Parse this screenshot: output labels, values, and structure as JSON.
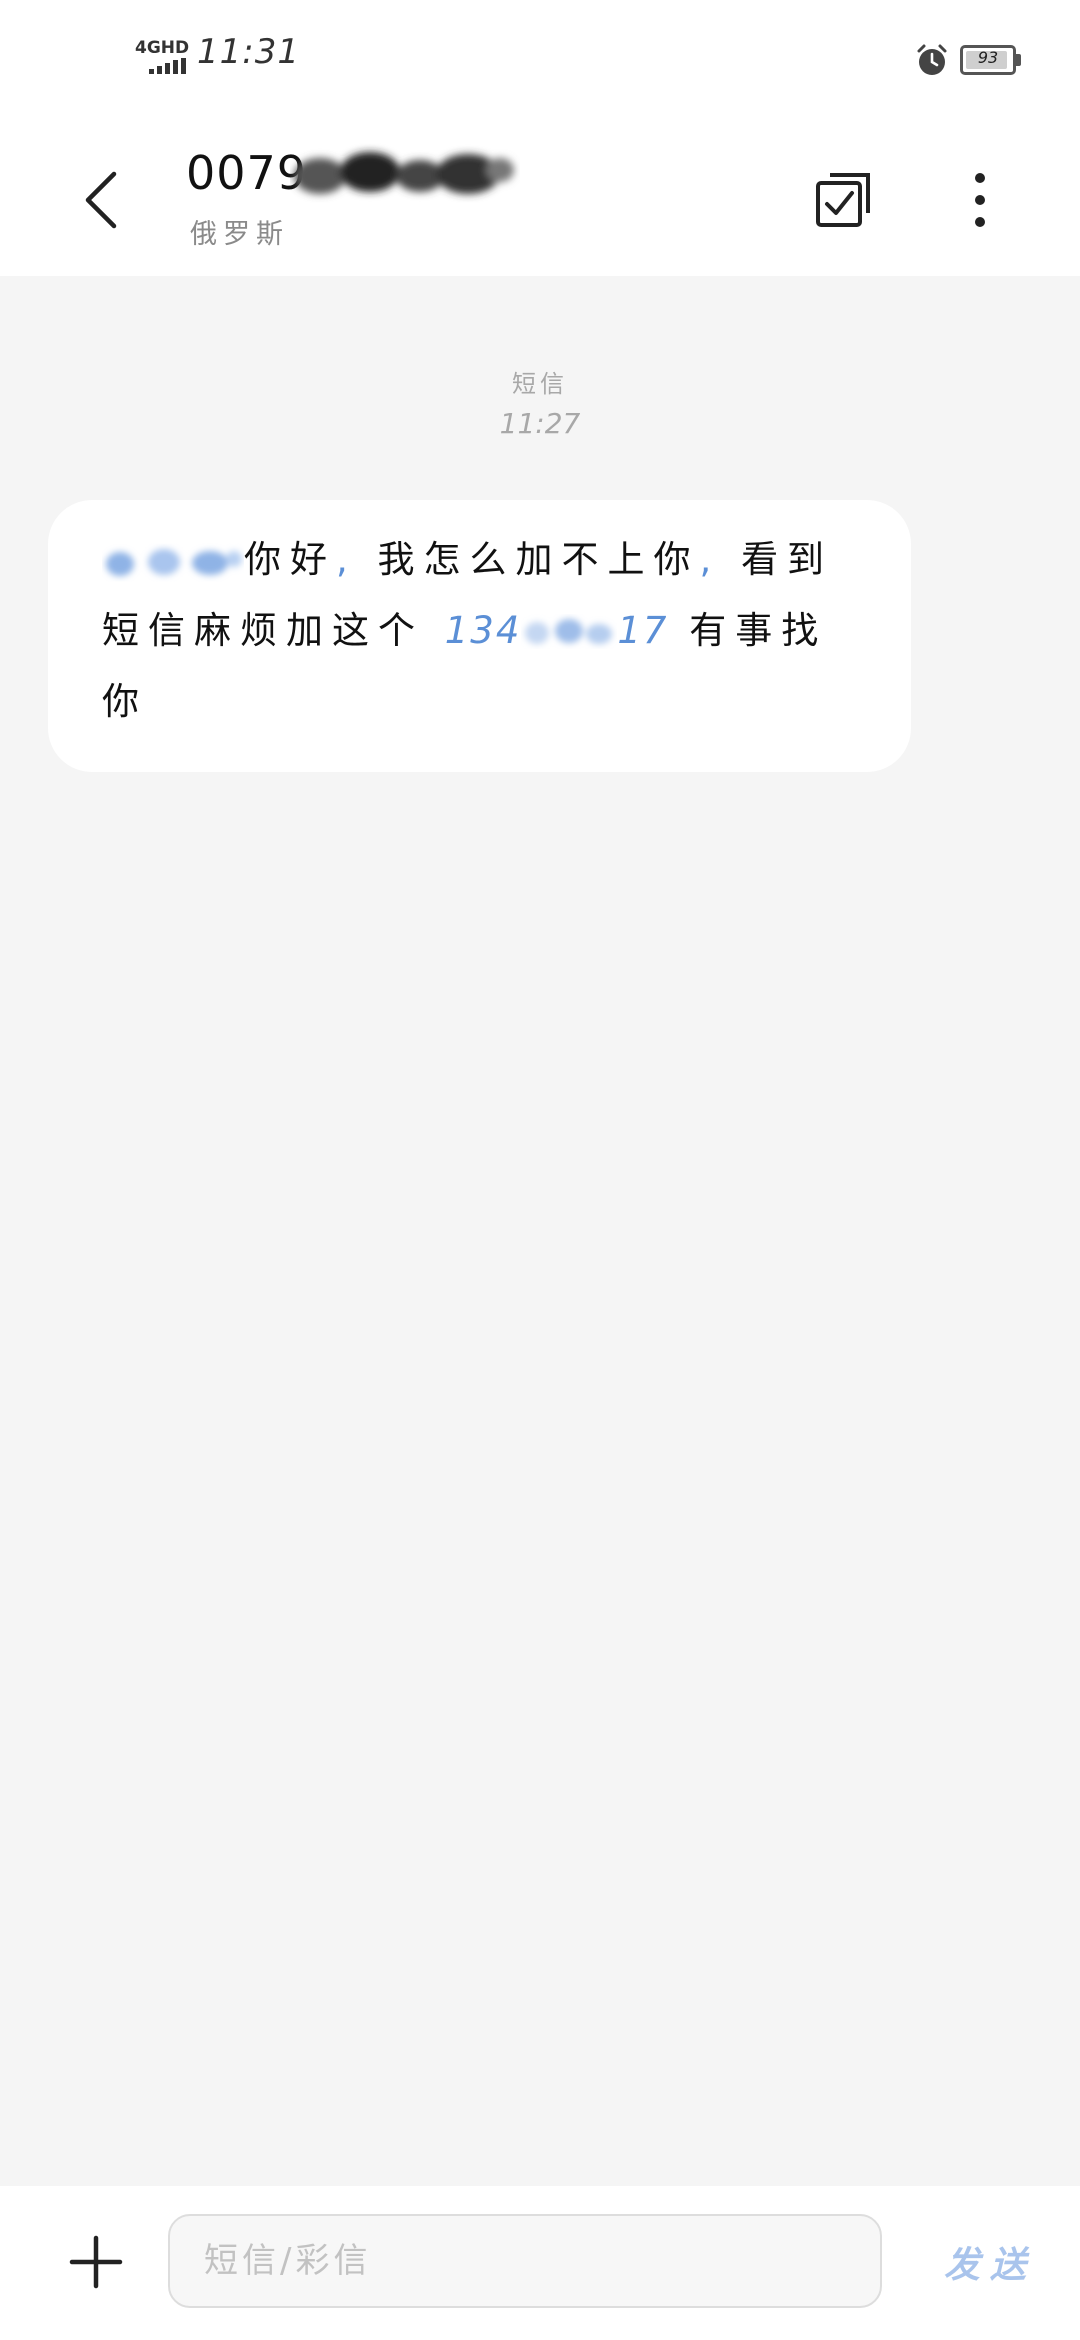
{
  "status_bar": {
    "network": "4GHD",
    "time": "11:31",
    "battery_level": "93",
    "battery_fraction": 0.93
  },
  "header": {
    "contact_number": "0079",
    "contact_country": "俄罗斯"
  },
  "conversation": {
    "message_type": "短信",
    "message_time": "11:27",
    "message": {
      "part1": "你好",
      "comma1": ",",
      "part2": "我怎么加不上你",
      "comma2": ",",
      "part3": "看到短信麻烦加这个",
      "number_prefix": "134",
      "number_suffix": "17",
      "part4": "有事找你"
    }
  },
  "input_bar": {
    "placeholder": "短信/彩信",
    "send_label": "发送"
  },
  "colors": {
    "link_blue": "#5b8fd6",
    "send_disabled": "#a9c4ec",
    "background": "#f5f5f5"
  },
  "icons": {
    "back": "chevron-left-icon",
    "select": "checkbox-multi-icon",
    "more": "more-vertical-icon",
    "add": "plus-icon",
    "alarm": "alarm-icon"
  }
}
